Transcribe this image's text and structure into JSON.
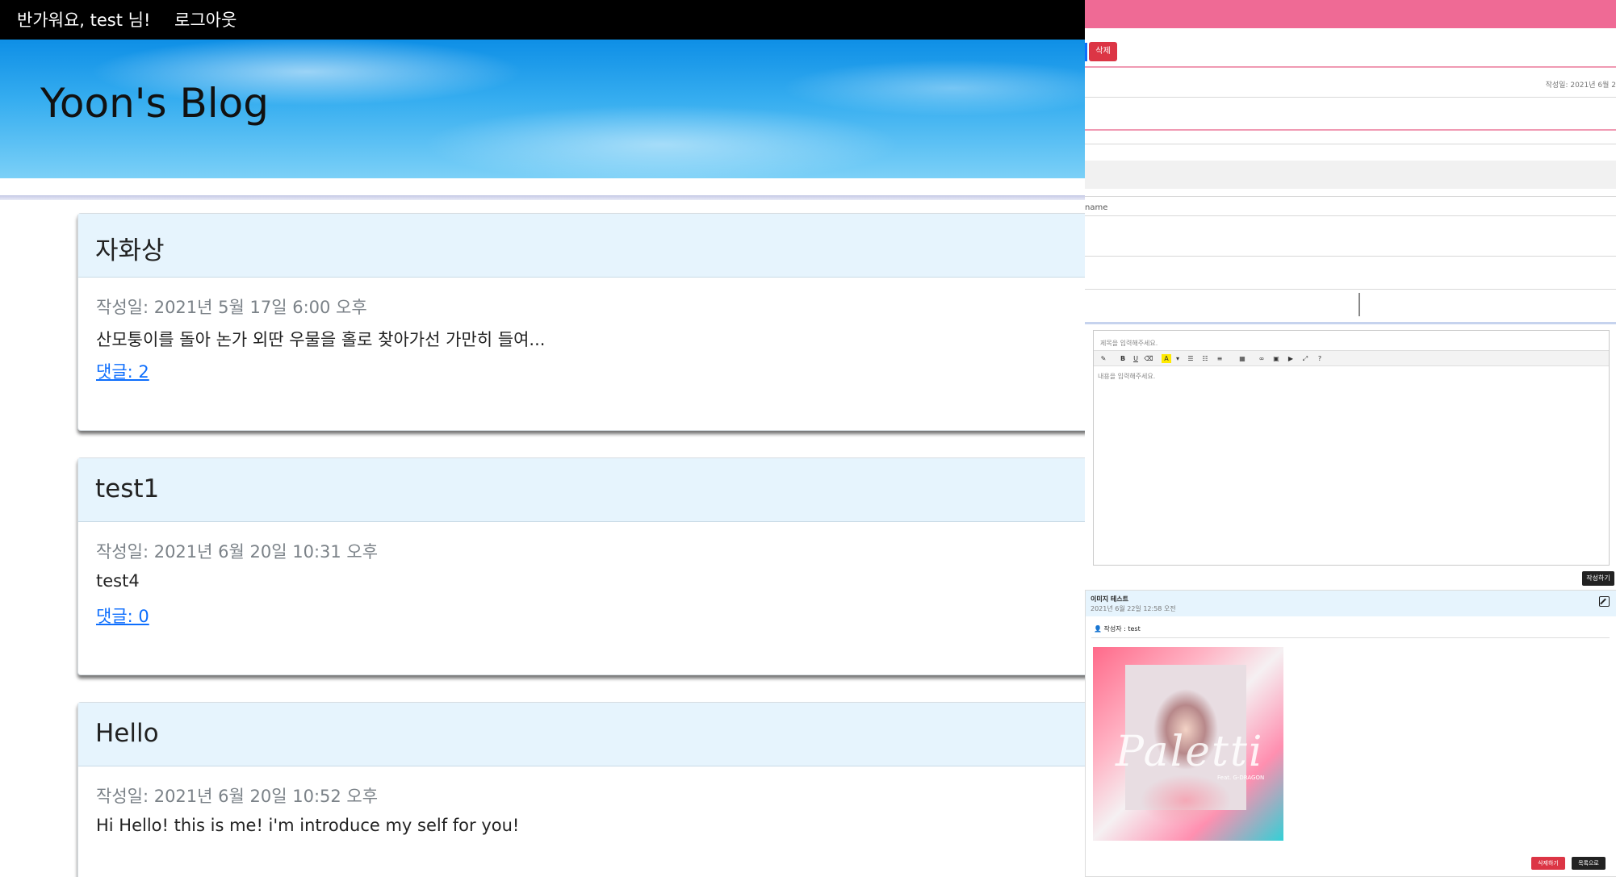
{
  "nav": {
    "greeting": "반가워요, test 님!",
    "logout": "로그아웃"
  },
  "hero": {
    "title": "Yoon's Blog"
  },
  "posts": [
    {
      "title": "자화상",
      "date": "작성일: 2021년 5월 17일 6:00 오후",
      "excerpt": "산모퉁이를 돌아 논가 외딴 우물을 홀로 찾아가선 가만히 들여...",
      "comments": "댓글: 2"
    },
    {
      "title": "test1",
      "date": "작성일: 2021년 6월 20일 10:31 오후",
      "excerpt": "test4",
      "comments": "댓글: 0"
    },
    {
      "title": "Hello",
      "date": "작성일: 2021년 6월 20일 10:52 오후",
      "excerpt": "Hi Hello! this is me! i'm introduce my self for you!",
      "comments": ""
    }
  ],
  "right": {
    "delete_label": "삭제",
    "date_fragment": "작성일: 2021년 6월 2",
    "name_fragment": "name",
    "editor": {
      "title_placeholder": "제목을 입력해주세요.",
      "body_placeholder": "내용을 입력해주세요.",
      "submit_label": "작성하기"
    },
    "post": {
      "title": "이미지 테스트",
      "date": "2021년 6월 22일 12:58 오전",
      "author": "작성자 : test",
      "album_script": "Paletti",
      "album_feat": "Feat. G-DRAGON",
      "delete_label": "삭제하기",
      "list_label": "목록으로"
    }
  }
}
